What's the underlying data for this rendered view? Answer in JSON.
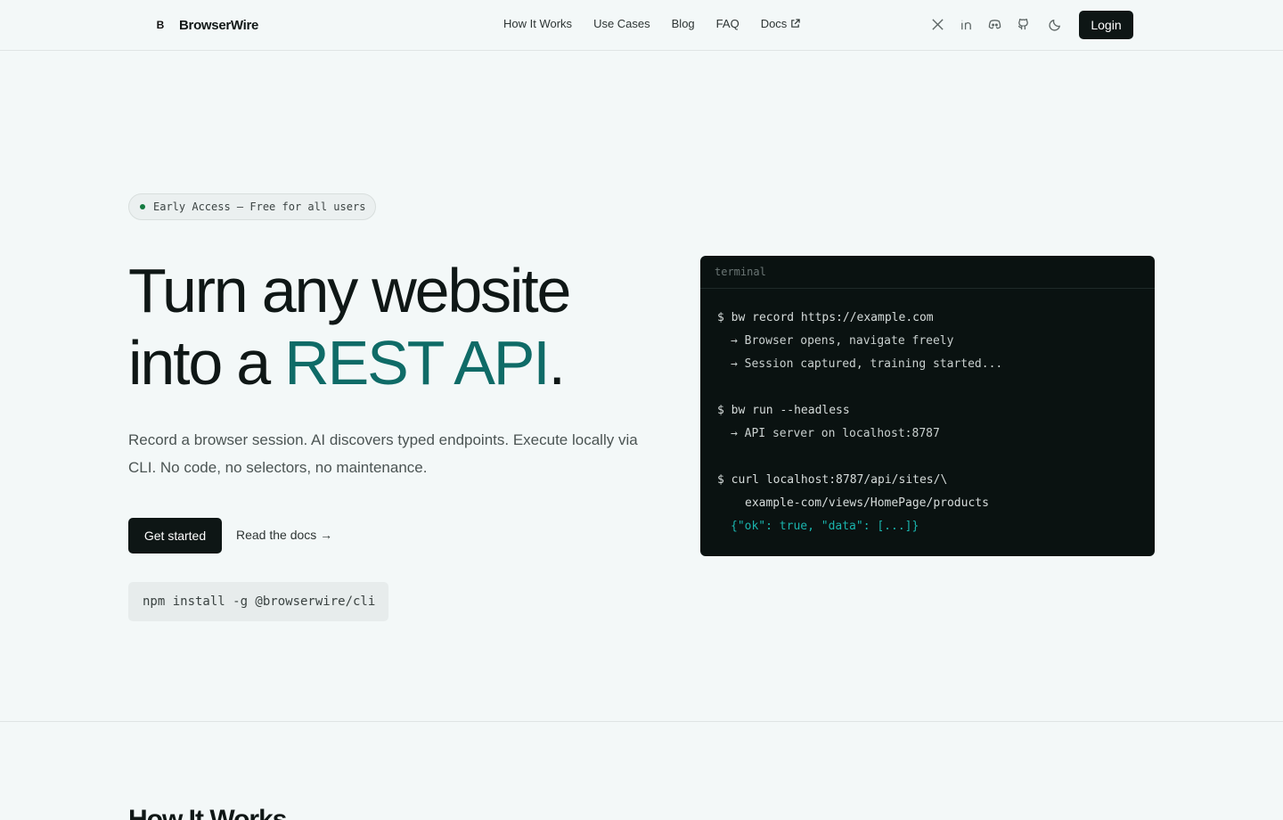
{
  "nav": {
    "brand": "BrowserWire",
    "brand_logo": "B",
    "links": [
      "How It Works",
      "Use Cases",
      "Blog",
      "FAQ",
      "Docs"
    ],
    "icons": [
      "x-icon",
      "linkedin-icon",
      "discord-icon",
      "github-icon",
      "moon-icon"
    ],
    "login_label": "Login"
  },
  "hero": {
    "badge": "Early Access — Free for all users",
    "headline_line1": "Turn any website",
    "headline_line2_prefix": "into a ",
    "headline_accent": "REST API",
    "headline_suffix": ".",
    "subtitle": "Record a browser session. AI discovers typed endpoints. Execute locally via CLI. No code, no selectors, no maintenance.",
    "cta_primary": "Get started",
    "cta_secondary": "Read the docs →",
    "install_command": "npm install -g @browserwire/cli"
  },
  "terminal": {
    "title": "terminal",
    "lines": [
      "$ bw record https://example.com",
      "→ Browser opens, navigate freely",
      "→ Session captured, training started...",
      "$ bw run --headless",
      "→ API server on localhost:8787",
      "$ curl localhost:8787/api/sites/\\",
      "example-com/views/HomePage/products",
      "{\"ok\": true, \"data\": [...]}"
    ]
  },
  "next_section": {
    "title": "How It Works"
  },
  "colors": {
    "background": "#f3f8f8",
    "accent": "#0f6b67",
    "dark": "#0e1615",
    "terminal_bg": "#0a1211",
    "json_accent": "#1ab4ad",
    "badge_dot": "#137a3f"
  }
}
